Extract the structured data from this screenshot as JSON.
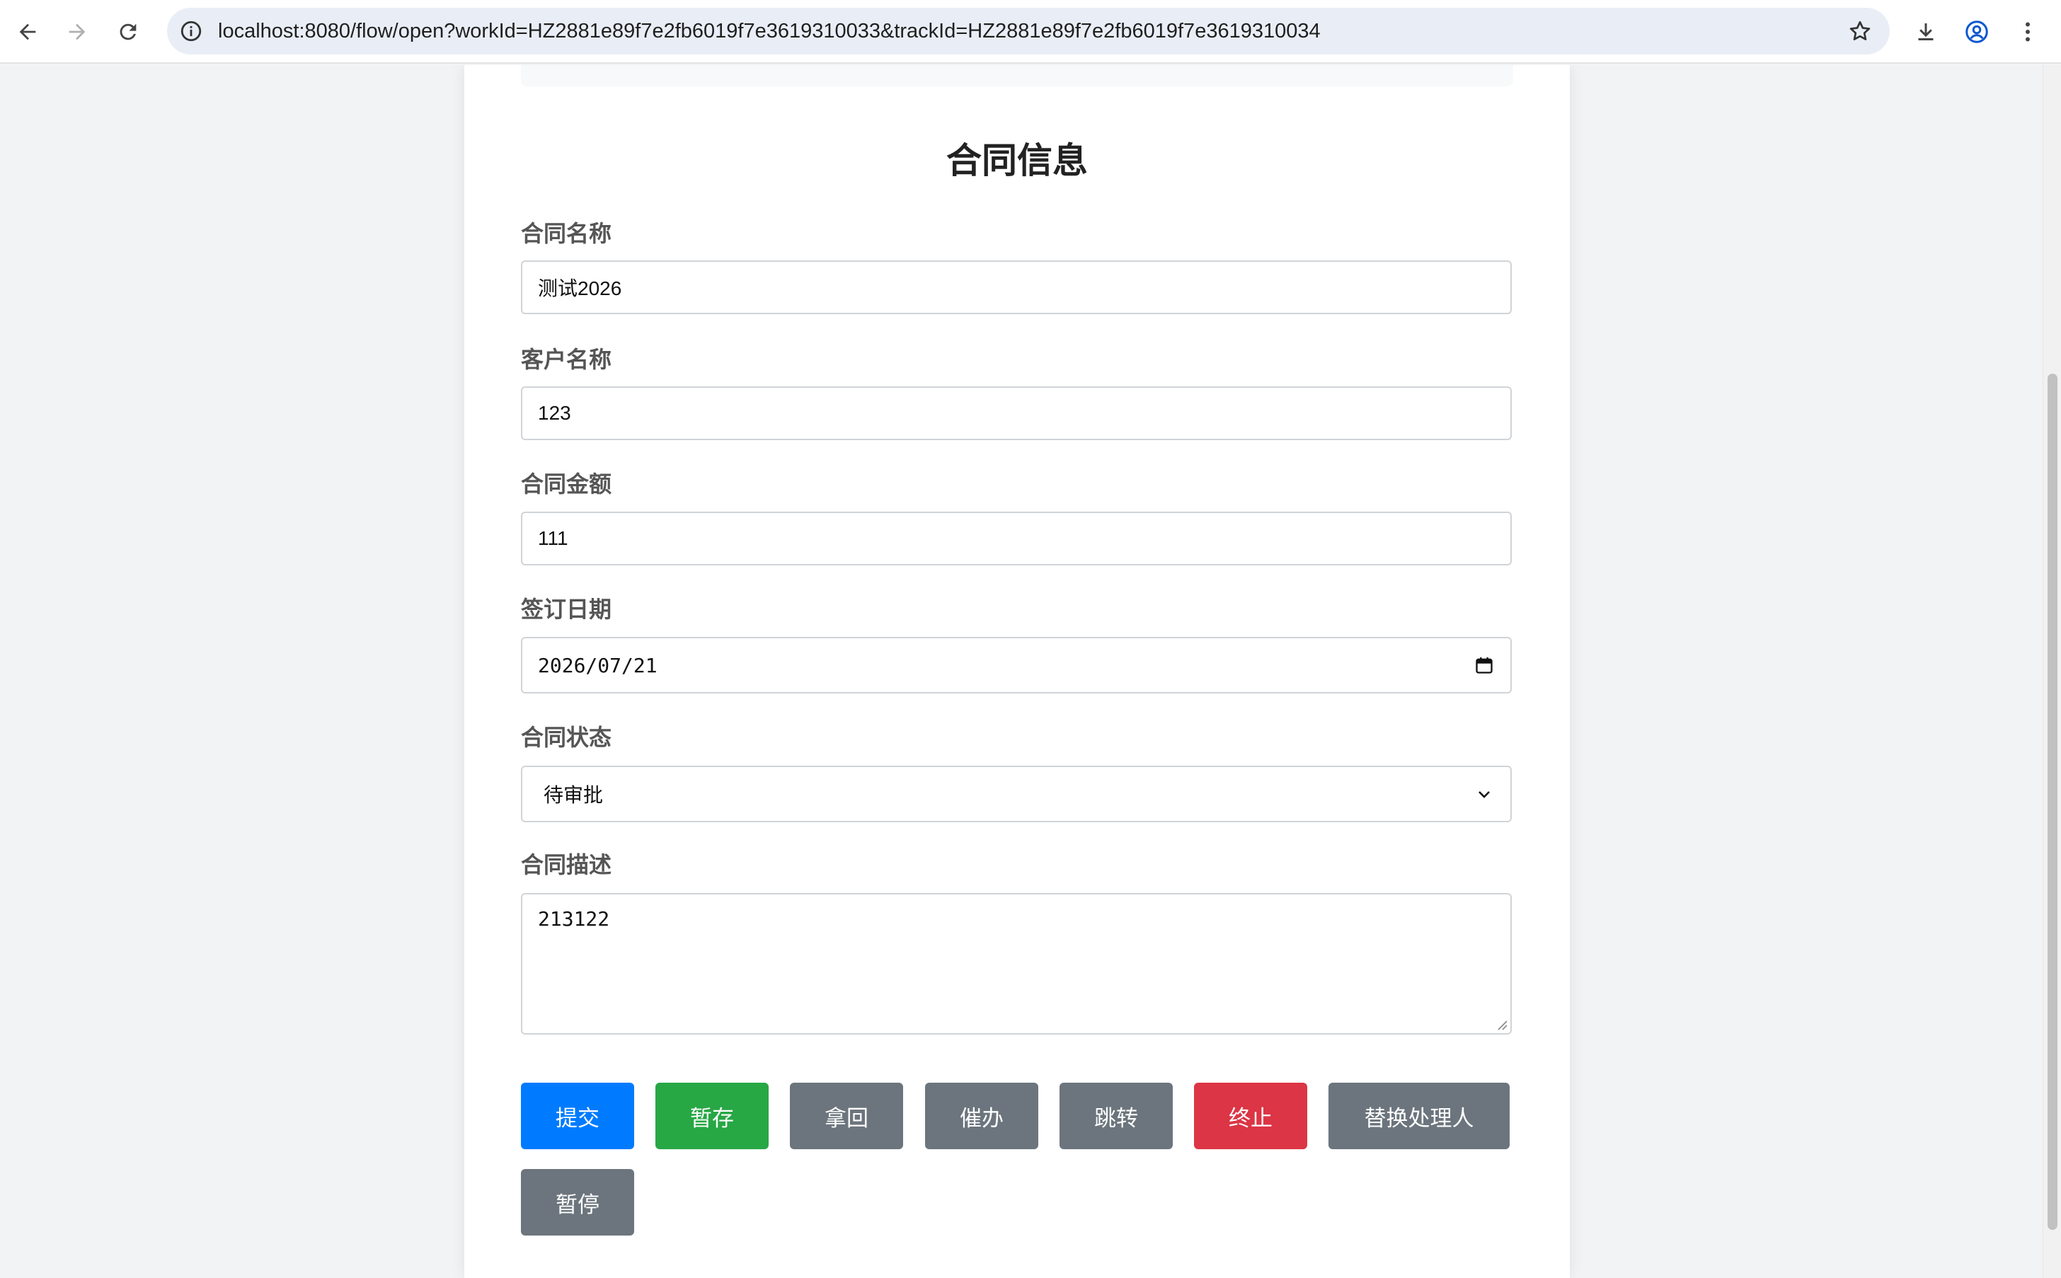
{
  "browser": {
    "url": "localhost:8080/flow/open?workId=HZ2881e89f7e2fb6019f7e3619310033&trackId=HZ2881e89f7e2fb6019f7e3619310034",
    "icons": {
      "back": "back-arrow-icon",
      "forward": "forward-arrow-icon",
      "reload": "reload-icon",
      "site_info": "info-icon",
      "bookmark": "star-icon",
      "download": "download-icon",
      "profile": "profile-icon",
      "menu": "kebab-menu-icon"
    }
  },
  "form": {
    "title": "合同信息",
    "fields": {
      "contract_name": {
        "label": "合同名称",
        "value": "测试2026"
      },
      "customer_name": {
        "label": "客户名称",
        "value": "123"
      },
      "contract_amount": {
        "label": "合同金额",
        "value": "111"
      },
      "sign_date": {
        "label": "签订日期",
        "value": "2026/07/21"
      },
      "contract_status": {
        "label": "合同状态",
        "value": "待审批"
      },
      "contract_description": {
        "label": "合同描述",
        "value": "213122"
      }
    },
    "buttons": {
      "submit": {
        "label": "提交",
        "color": "#007bff"
      },
      "save_draft": {
        "label": "暂存",
        "color": "#28a745"
      },
      "retrieve": {
        "label": "拿回",
        "color": "#6c757d"
      },
      "urge": {
        "label": "催办",
        "color": "#6c757d"
      },
      "jump": {
        "label": "跳转",
        "color": "#6c757d"
      },
      "terminate": {
        "label": "终止",
        "color": "#dc3545"
      },
      "replace_handler": {
        "label": "替换处理人",
        "color": "#6c757d"
      },
      "pause": {
        "label": "暂停",
        "color": "#6c757d"
      }
    }
  }
}
